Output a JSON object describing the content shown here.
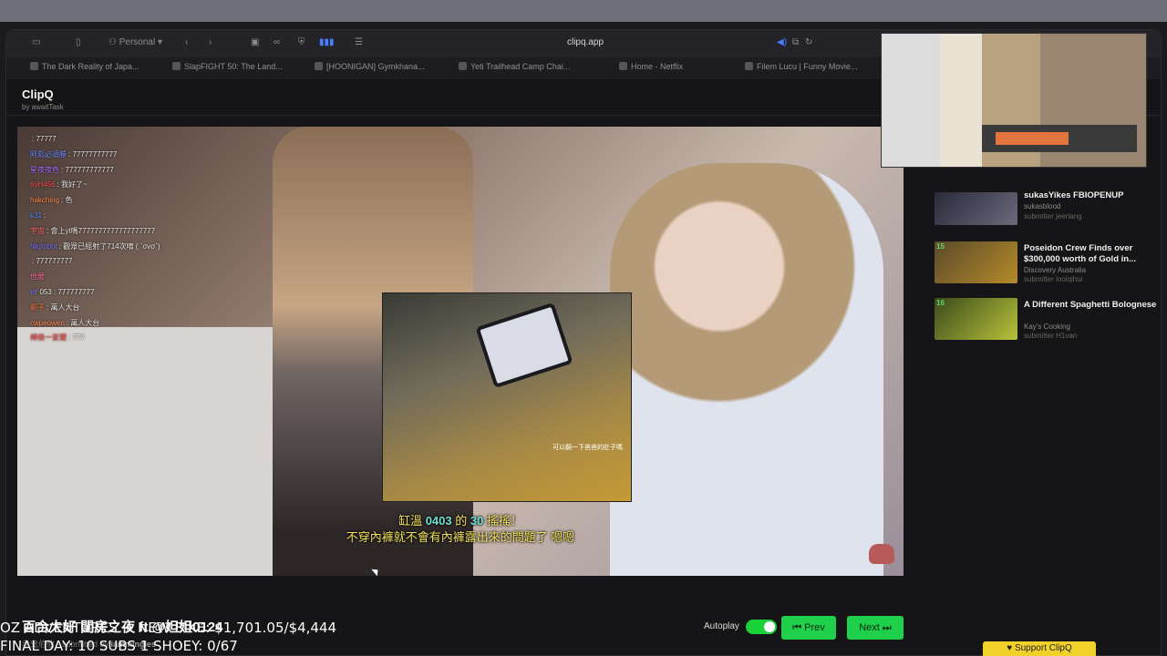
{
  "browser": {
    "profile": "Personal",
    "address": "clipq.app",
    "tabs": [
      {
        "label": "The Dark Reality of Japa..."
      },
      {
        "label": "SlapFIGHT 50: The Land..."
      },
      {
        "label": "[HOONIGAN] Gymkhana..."
      },
      {
        "label": "Yeti Trailhead Camp Chai..."
      },
      {
        "label": "Home - Netflix"
      },
      {
        "label": "Filem Lucu | Funny Movie..."
      }
    ]
  },
  "app": {
    "name": "ClipQ",
    "byline": "by awaitTask"
  },
  "chat": [
    {
      "user": "",
      "msg": ": 77777"
    },
    {
      "user": "阿彪必須勝",
      "msg": ": 77777777777"
    },
    {
      "user": "星夜夜色",
      "msg": ": 777777777777"
    },
    {
      "user": "6yH456",
      "msg": ": 我好了~"
    },
    {
      "user": "hakching",
      "msg": ": 色"
    },
    {
      "user": "k31",
      "msg": ":"
    },
    {
      "user": "宇宙",
      "msg": ": 會上yt嗎7777777777777777777"
    },
    {
      "user": "Nightbot",
      "msg": ": 觀眾已經射了714次唷 ( ˊσvσˋ)"
    },
    {
      "user": "",
      "msg": ": 777777777"
    },
    {
      "user": "他麼",
      "msg": ""
    },
    {
      "user": "vir",
      "msg": "053 : 777777777"
    },
    {
      "user": "影子",
      "msg": ": 萬人大台"
    },
    {
      "user": "cwpeowen",
      "msg": ": 萬人大台"
    },
    {
      "user": "樺條一家爾",
      "msg": ": 777"
    }
  ],
  "pip_caption": "可以翻一下爸爸的肚子嗎",
  "subtitle": {
    "line1_pre": "缸溫 ",
    "line1_num1": "0403",
    "line1_mid": " 的 ",
    "line1_num2": "30",
    "line1_post": " 搖搖！",
    "line2": "不穿內褲就不會有內褲露出來的問題了 嗯嗯"
  },
  "clip": {
    "title": "百合大好 閨房之夜 ft.@妲妲0124",
    "channel": "赤鬼伯伯",
    "submitted_prefix": " - submitted by ",
    "submitter": "iammingles"
  },
  "controls": {
    "autoplay_label": "Autoplay",
    "autoplay_on": true,
    "prev_label": "⏮ Prev",
    "next_label": "Next ⏭"
  },
  "queue": [
    {
      "rank": "",
      "title": "sukasYikes FBIOPENUP",
      "channel": "sukasblood",
      "submitter": "submitter jeerlang"
    },
    {
      "rank": "15",
      "title": "Poseidon Crew Finds over $300,000 worth of Gold in...",
      "channel": "Discovery Australia",
      "submitter": "submitter looiqihui"
    },
    {
      "rank": "16",
      "title": "A Different Spaghetti Bolognese",
      "channel": "Kay's Cooking",
      "submitter": "submitter H1van"
    }
  ],
  "stream_overlay": {
    "line1": "OZ ADVENTURES + NEW BIKE: $1,701.05/$4,444",
    "line2": "FINAL DAY: 10 SUBS 1 SHOEY: 0/67"
  },
  "support_label": "Support ClipQ",
  "colors": {
    "accent": "#1fd14a",
    "subtitle": "#f2e15e",
    "subtitle_num": "#6fe2d4"
  }
}
